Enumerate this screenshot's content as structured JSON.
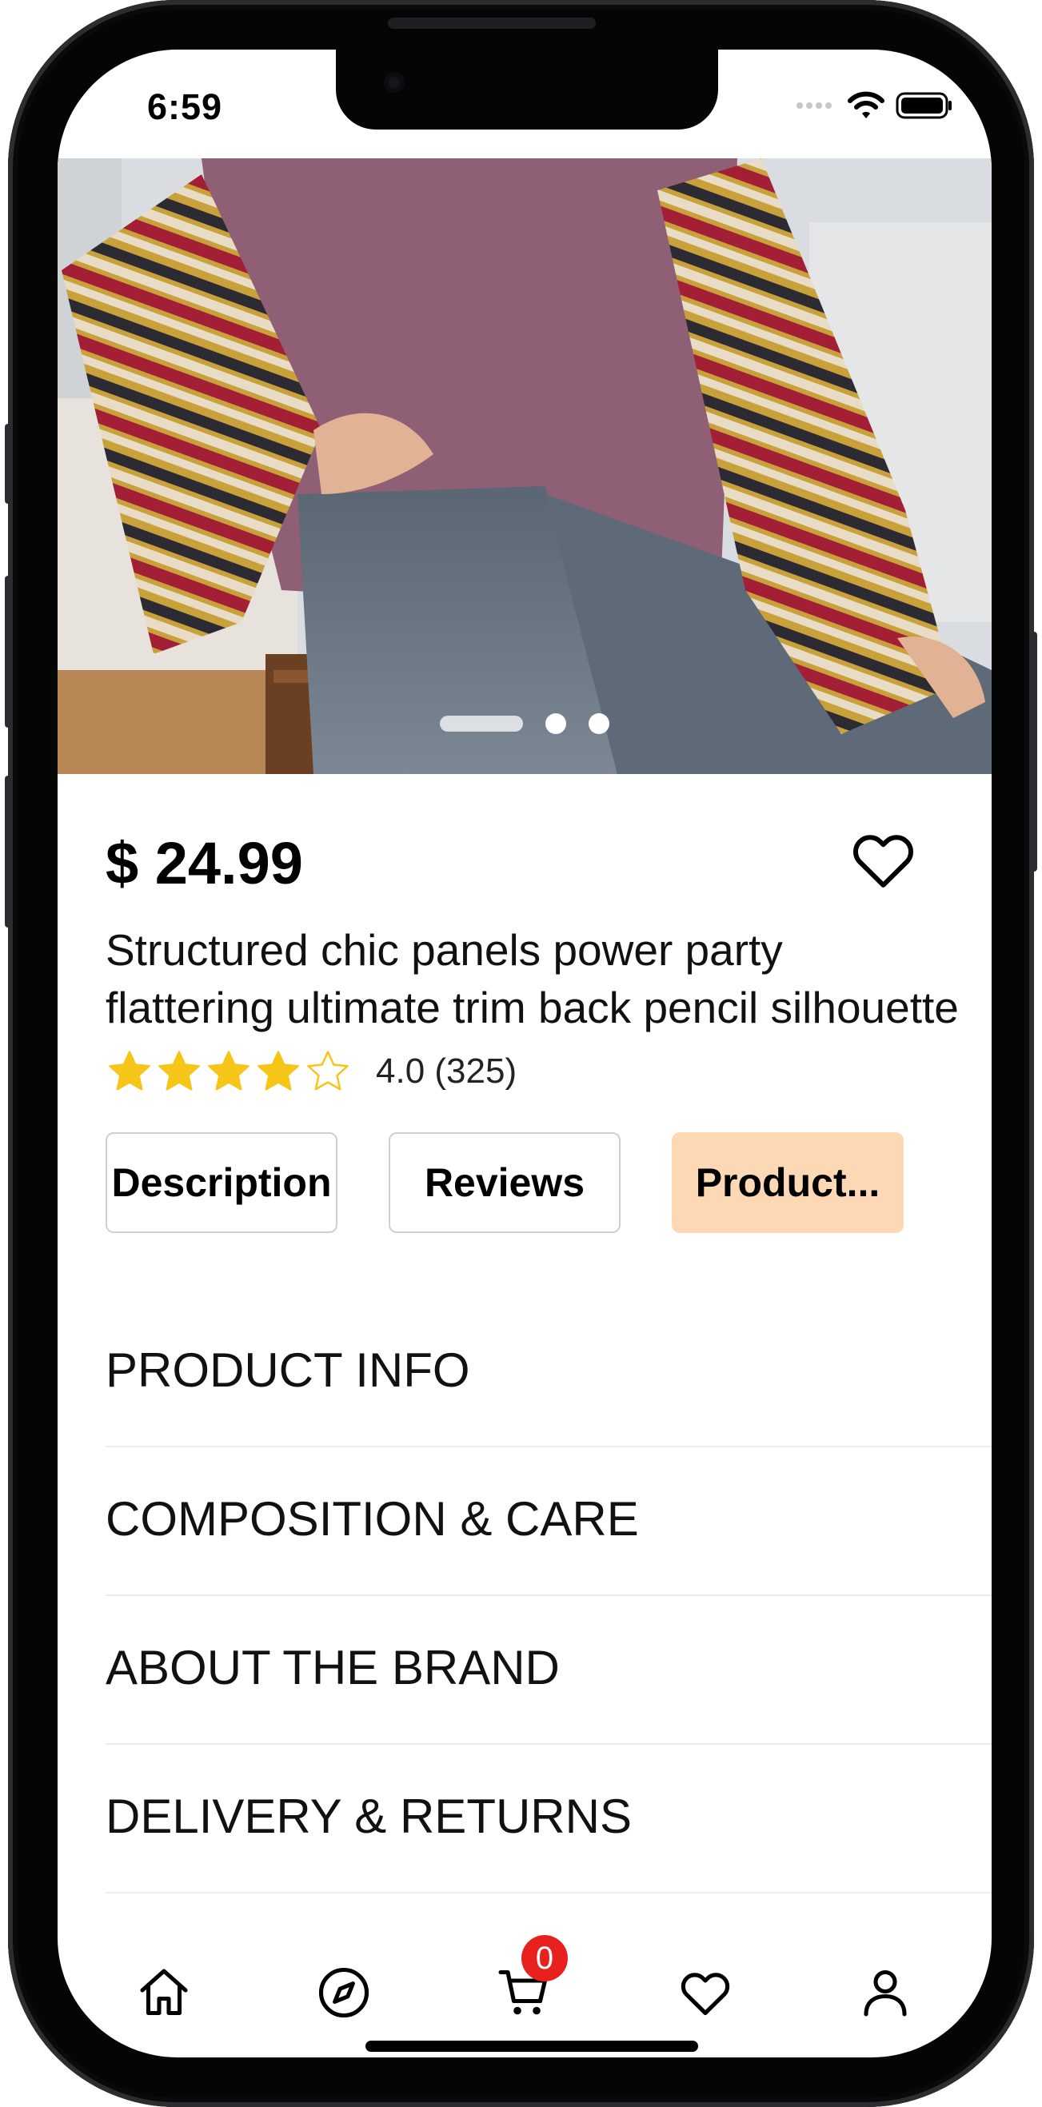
{
  "status_bar": {
    "time": "6:59"
  },
  "product": {
    "price": "$ 24.99",
    "title_line1": "Structured chic panels power party",
    "title_line2": "flattering ultimate trim back pencil silhouette",
    "rating": 4.0,
    "rating_text": "4.0 (325)",
    "image_count": 3,
    "active_image": 1
  },
  "tabs": [
    {
      "label": "Description",
      "active": false
    },
    {
      "label": "Reviews",
      "active": false
    },
    {
      "label": "Product...",
      "active": true
    }
  ],
  "sections": [
    {
      "label": "PRODUCT INFO"
    },
    {
      "label": "COMPOSITION & CARE"
    },
    {
      "label": "ABOUT THE BRAND"
    },
    {
      "label": "DELIVERY & RETURNS"
    }
  ],
  "tab_bar": {
    "items": [
      "home-icon",
      "explore-compass-icon",
      "cart-icon",
      "wishlist-heart-icon",
      "profile-icon"
    ],
    "cart_badge": "0"
  },
  "colors": {
    "accent_tab": "#fdd8b5",
    "star": "#f5c518",
    "badge": "#e8211f"
  }
}
